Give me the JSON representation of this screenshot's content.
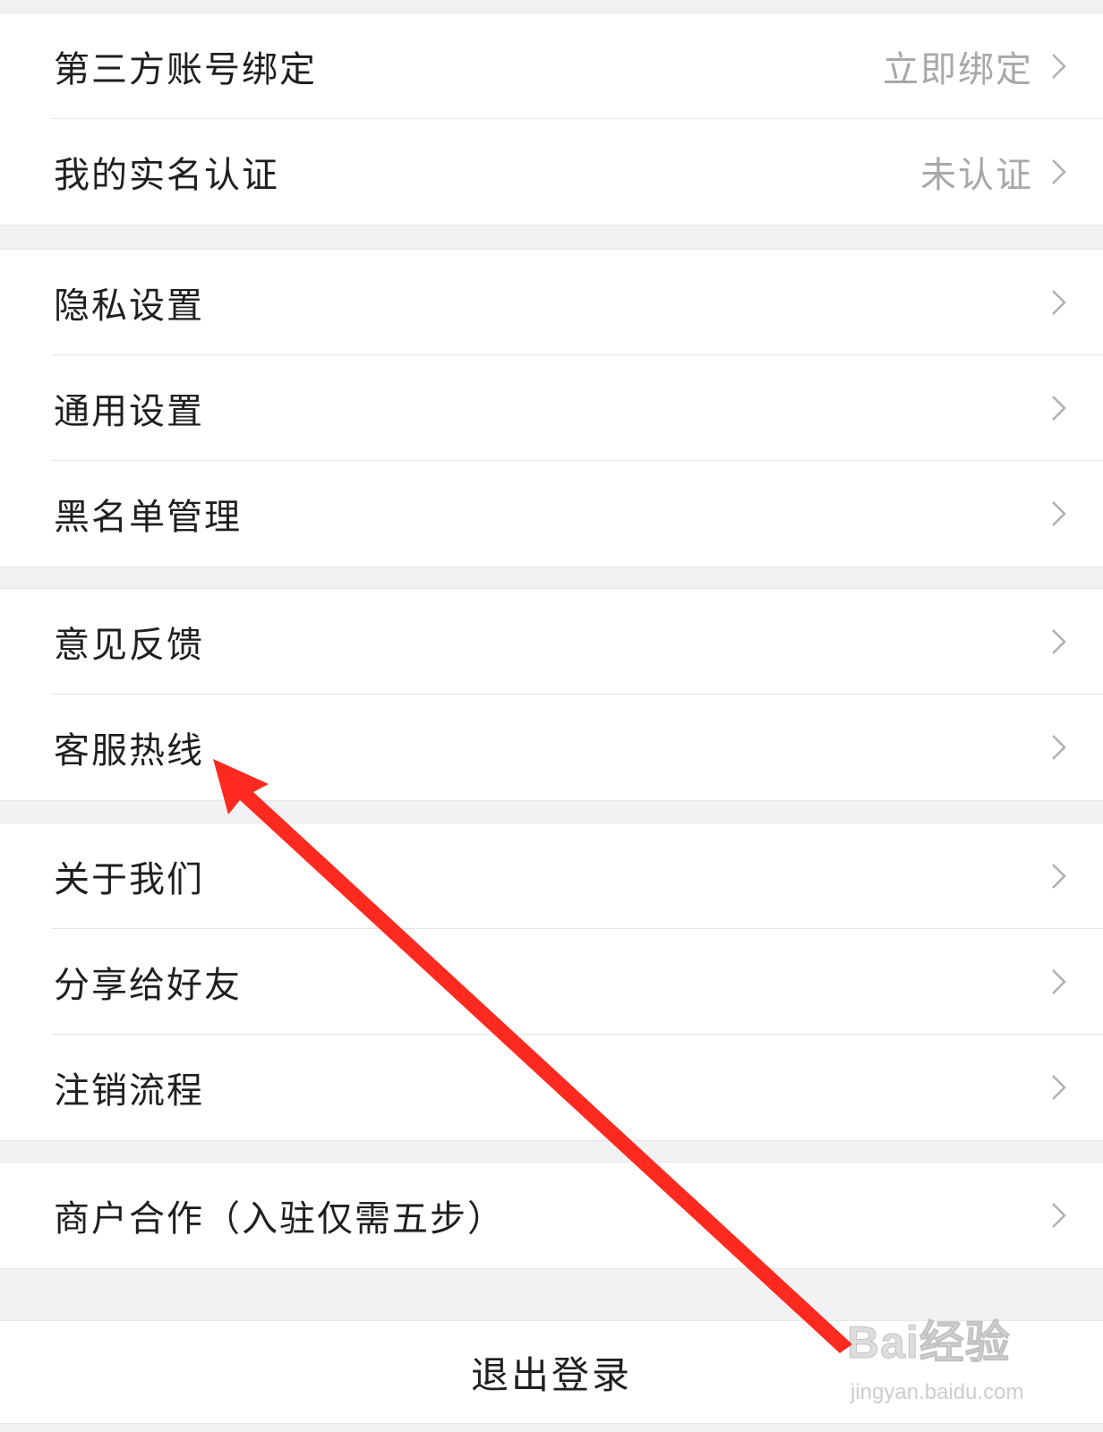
{
  "groups": [
    {
      "items": [
        {
          "label": "第三方账号绑定",
          "value": "立即绑定"
        },
        {
          "label": "我的实名认证",
          "value": "未认证"
        }
      ]
    },
    {
      "items": [
        {
          "label": "隐私设置"
        },
        {
          "label": "通用设置"
        },
        {
          "label": "黑名单管理"
        }
      ]
    },
    {
      "items": [
        {
          "label": "意见反馈"
        },
        {
          "label": "客服热线"
        }
      ]
    },
    {
      "items": [
        {
          "label": "关于我们"
        },
        {
          "label": "分享给好友"
        },
        {
          "label": "注销流程"
        }
      ]
    },
    {
      "items": [
        {
          "label": "商户合作（入驻仅需五步）"
        }
      ]
    }
  ],
  "logout": {
    "label": "退出登录"
  },
  "annotation": {
    "color": "#ff2a1f",
    "points_to": "客服热线"
  },
  "watermark": {
    "brand": "Bai经验",
    "site": "jingyan.baidu.com"
  },
  "colors": {
    "background": "#f2f2f4",
    "row": "#ffffff",
    "label": "#1f1f1f",
    "value": "#a8a8a8",
    "chevron": "#b0b0b0"
  }
}
